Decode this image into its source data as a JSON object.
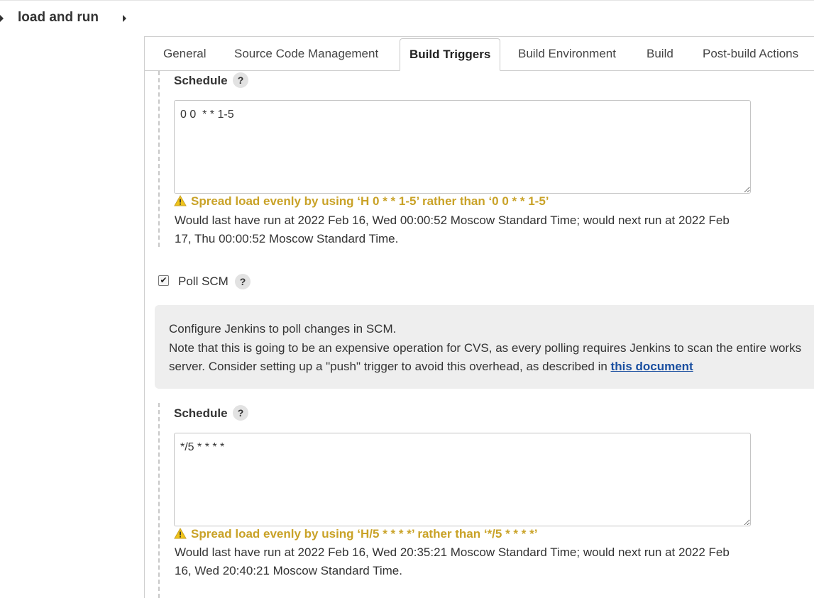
{
  "breadcrumb": {
    "title": "load and run"
  },
  "tabs": [
    {
      "label": "General"
    },
    {
      "label": "Source Code Management"
    },
    {
      "label": "Build Triggers"
    },
    {
      "label": "Build Environment"
    },
    {
      "label": "Build"
    },
    {
      "label": "Post-build Actions"
    }
  ],
  "active_tab": "Build Triggers",
  "build_periodically": {
    "schedule_label": "Schedule",
    "help": "?",
    "schedule_value": "0 0  * * 1-5",
    "warning": "Spread load evenly by using ‘H 0  * * 1-5’ rather than ‘0 0  * * 1-5’",
    "info_line1": "Would last have run at 2022 Feb 16, Wed 00:00:52 Moscow Standard Time; would next run at 2022 Feb",
    "info_line2": "17, Thu 00:00:52 Moscow Standard Time."
  },
  "poll_scm": {
    "checked": true,
    "label": "Poll SCM",
    "help": "?",
    "help_line1": "Configure Jenkins to poll changes in SCM.",
    "help_line2": "Note that this is going to be an expensive operation for CVS, as every polling requires Jenkins to scan the entire works",
    "help_line3": "server. Consider setting up a \"push\" trigger to avoid this overhead, as described in",
    "help_link": "this document",
    "schedule_label": "Schedule",
    "schedule_help": "?",
    "schedule_value": "*/5 * * * *",
    "warning": "Spread load evenly by using ‘H/5 * * * *’ rather than ‘*/5 * * * *’",
    "info_line1": "Would last have run at 2022 Feb 16, Wed 20:35:21 Moscow Standard Time; would next run at 2022 Feb",
    "info_line2": "16, Wed 20:40:21 Moscow Standard Time."
  },
  "colors": {
    "warning": "#c9a227",
    "link": "#1a4fa0",
    "help_bg": "#eeeeee"
  }
}
